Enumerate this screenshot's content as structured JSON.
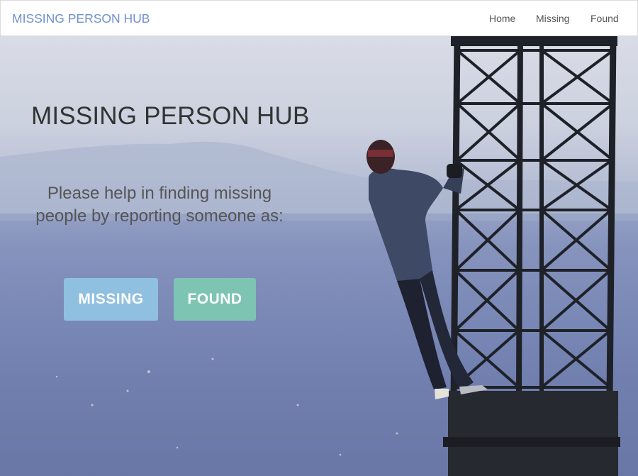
{
  "nav": {
    "brand": "MISSING PERSON HUB",
    "links": [
      "Home",
      "Missing",
      "Found"
    ]
  },
  "hero": {
    "title": "MISSING PERSON HUB",
    "line1": "Please help in finding missing",
    "line2": "people by reporting someone as:",
    "missing_button": "MISSING",
    "found_button": "FOUND"
  },
  "colors": {
    "brand": "#6f8fce",
    "missing_button": "#8fc0e0",
    "found_button": "#7ec4b3"
  }
}
